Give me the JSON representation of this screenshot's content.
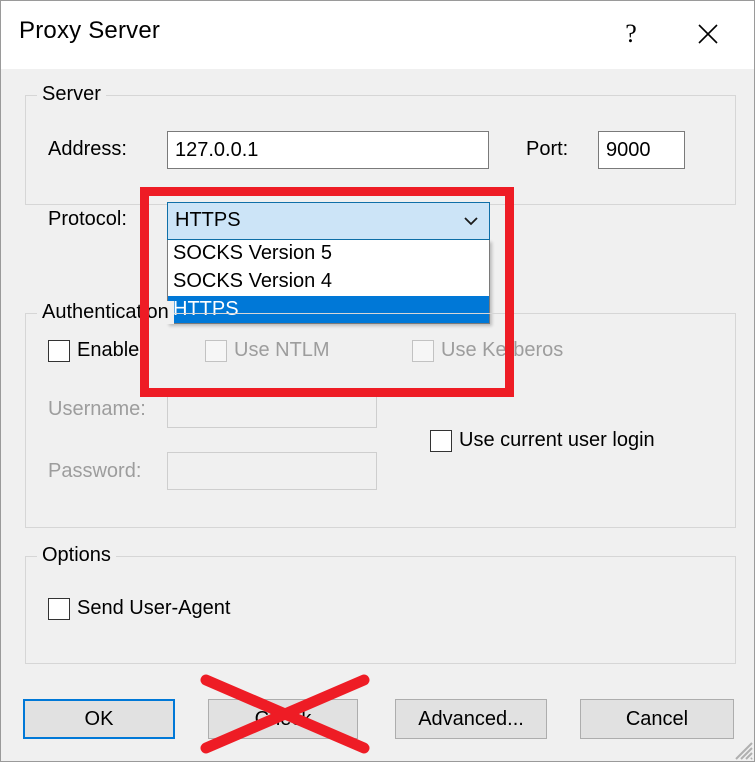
{
  "window": {
    "title": "Proxy Server",
    "help_glyph": "?",
    "help_tooltip": "Help",
    "close_tooltip": "Close"
  },
  "server_group": {
    "legend": "Server",
    "address_label": "Address:",
    "address_value": "127.0.0.1",
    "address_placeholder": "",
    "port_label": "Port:",
    "port_value": "9000",
    "port_placeholder": "",
    "protocol_label": "Protocol:",
    "protocol_selected": "HTTPS",
    "protocol_options": [
      "SOCKS Version 5",
      "SOCKS Version 4",
      "HTTPS"
    ]
  },
  "auth_group": {
    "legend": "Authentication",
    "enable_label": "Enable",
    "ntlm_label": "Use NTLM",
    "kerberos_label": "Use Kerberos",
    "username_label": "Username:",
    "username_value": "",
    "username_placeholder": "",
    "password_label": "Password:",
    "password_value": "",
    "password_placeholder": "",
    "current_user_label": "Use current user login"
  },
  "options_group": {
    "legend": "Options",
    "send_user_agent_label": "Send User-Agent"
  },
  "buttons": {
    "ok": "OK",
    "check": "Check",
    "advanced": "Advanced...",
    "cancel": "Cancel"
  },
  "annotations": {
    "color": "#ee1c25",
    "highlight_target": "Protocol dropdown",
    "crossed_out_target": "Check"
  },
  "colors": {
    "dialog_background": "#f0f0f0",
    "titlebar_background": "#ffffff",
    "selection_blue": "#0078d7",
    "combo_hover_blue": "#cce4f7",
    "focus_border": "#0078d7",
    "disabled_text": "#9d9d9d",
    "annotation_red": "#ee1c25"
  }
}
